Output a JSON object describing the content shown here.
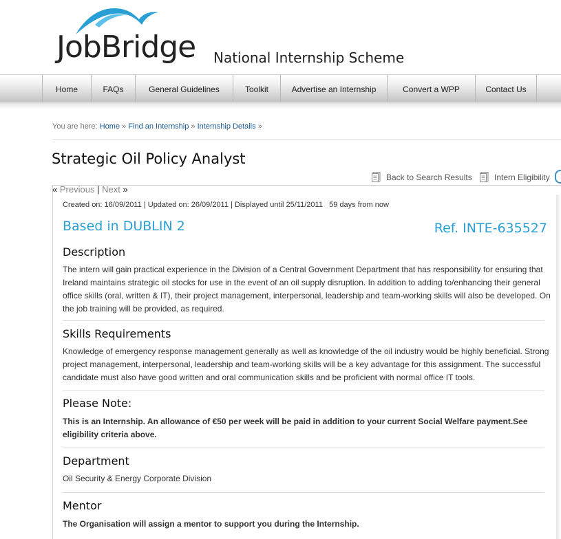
{
  "header": {
    "logo_text": "JobBridge",
    "tagline": "National Internship Scheme"
  },
  "nav": {
    "items": [
      {
        "label": "Home"
      },
      {
        "label": "FAQs"
      },
      {
        "label": "General Guidelines"
      },
      {
        "label": "Toolkit"
      },
      {
        "label": "Advertise an Internship"
      },
      {
        "label": "Convert a WPP"
      },
      {
        "label": "Contact Us"
      }
    ]
  },
  "breadcrumb": {
    "prefix": "You are here:",
    "items": [
      "Home",
      "Find an Internship",
      "Internship Details"
    ],
    "sep": "»"
  },
  "page": {
    "title": "Strategic Oil Policy Analyst"
  },
  "actions": {
    "back_label": "Back to Search Results",
    "eligibility_label": "Intern Eligibility"
  },
  "pager": {
    "prev_arrow": "«",
    "prev_label": "Previous",
    "divider": "|",
    "next_label": "Next",
    "next_arrow": "»"
  },
  "listing": {
    "meta": "Created on: 16/09/2011 | Updated on: 26/09/2011 | Displayed until 25/11/2011   59 days from now",
    "location": "Based in DUBLIN 2",
    "ref": "Ref. INTE-635527",
    "sections": [
      {
        "heading": "Description",
        "body": "The intern will gain practical experience in the Division of a Central Government Department that has responsibility for ensuring that Ireland maintains strategic oil stocks for use in the event of an oil supply disruption. In addition to adding to/enhancing their general office skills (oral, written & IT), their project management, interpersonal, leadership and team-working skills will also be developed. On the job training will be provided, as required."
      },
      {
        "heading": "Skills Requirements",
        "body": "Knowledge of emergency response management generally as well as knowledge of the oil industry would be highly beneficial. Strong project management, interpersonal, leadership and team-working skills will be a key advantage for this assignment. The successful candidate must also have good written and oral communication skills and be proficient with normal office IT tools."
      },
      {
        "heading": "Please Note:",
        "body": "This is an Internship. An allowance of €50 per week will be paid in addition to your current Social Welfare payment.See eligibility criteria above."
      },
      {
        "heading": "Department",
        "body": "Oil Security & Energy Corporate Division"
      },
      {
        "heading": "Mentor",
        "body": "The Organisation will assign a mentor to support you during the Internship."
      }
    ]
  },
  "colors": {
    "accent": "#2a9fd6",
    "link": "#1a5a96"
  }
}
